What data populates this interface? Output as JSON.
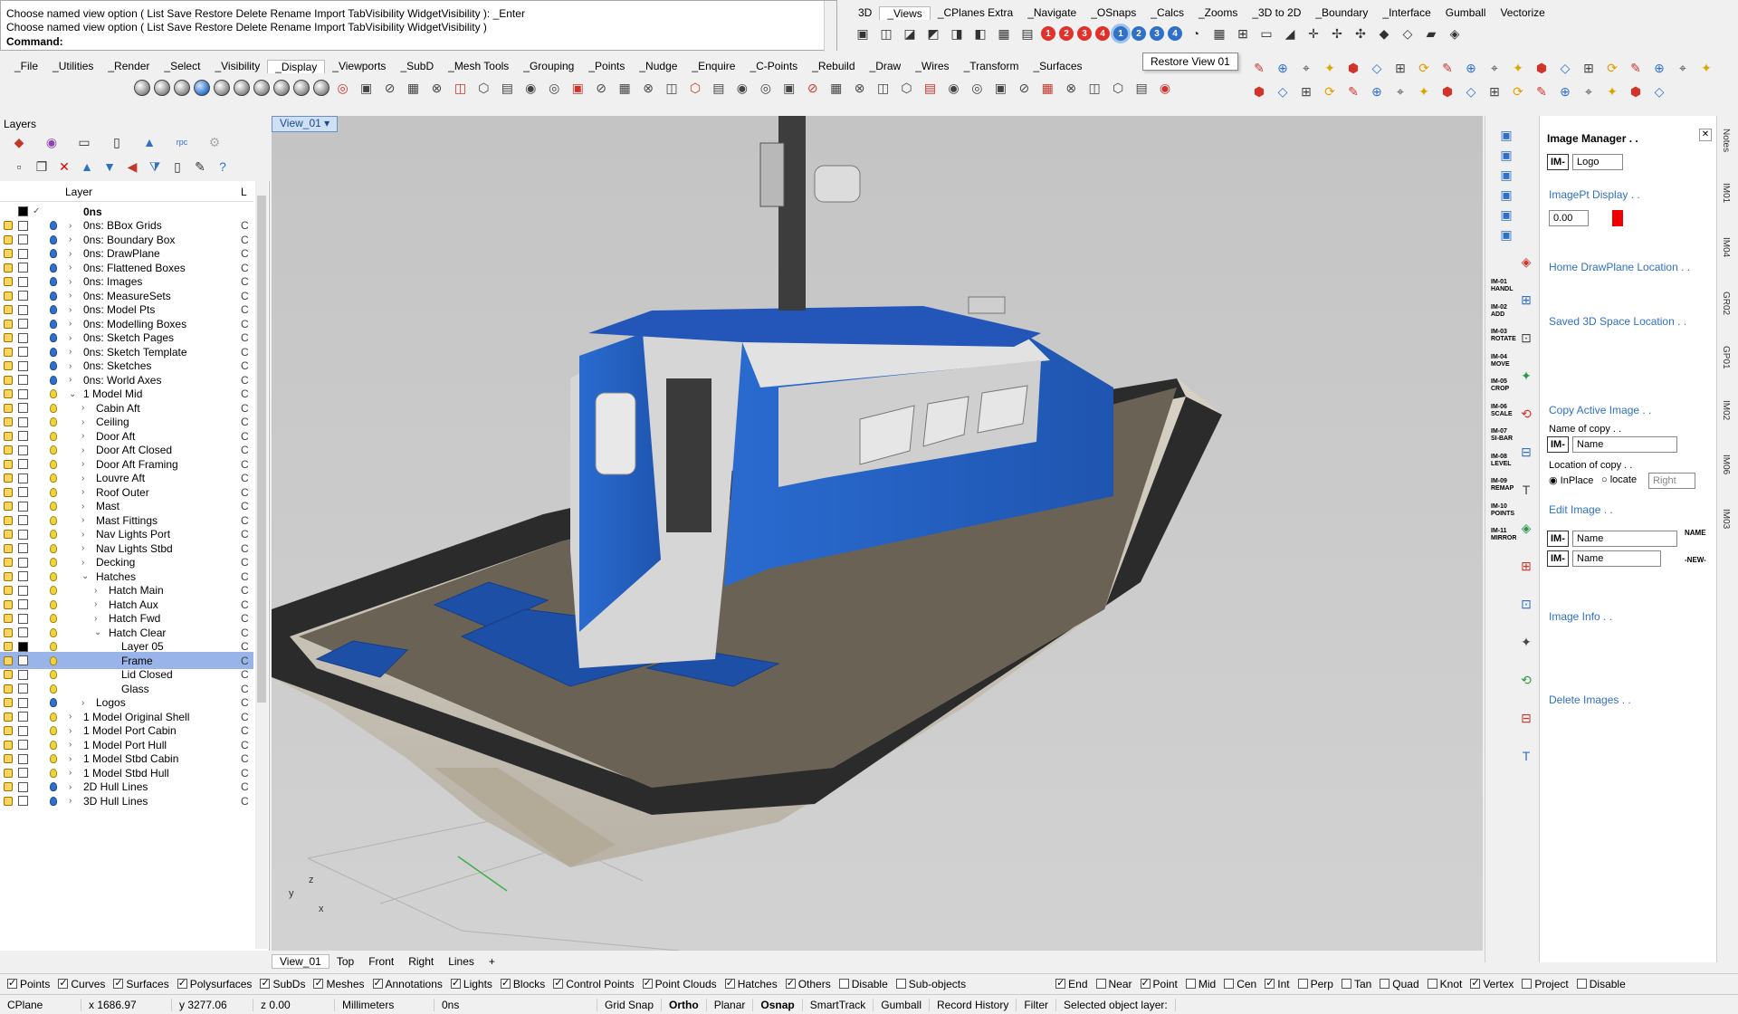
{
  "command": {
    "history": [
      "Choose named view option ( List  Save  Restore  Delete  Rename  Import  TabVisibility  WidgetVisibility ): _Enter",
      "Choose named view option ( List  Save  Restore  Delete  Rename  Import  TabVisibility  WidgetVisibility )"
    ],
    "prompt": "Command:"
  },
  "top_tabs_right": [
    "3D",
    "_Views",
    "_CPlanes Extra",
    "_Navigate",
    "_OSnaps",
    "_Calcs",
    "_Zooms",
    "_3D to 2D",
    "_Boundary",
    "_Interface",
    "Gumball",
    "Vectorize"
  ],
  "top_tabs_right_active": "_Views",
  "main_tabs": [
    "_File",
    "_Utilities",
    "_Render",
    "_Select",
    "_Visibility",
    "_Display",
    "_Viewports",
    "_SubD",
    "_Mesh Tools",
    "_Grouping",
    "_Points",
    "_Nudge",
    "_Enquire",
    "_C-Points",
    "_Rebuild",
    "_Draw",
    "_Wires",
    "_Transform",
    "_Surfaces"
  ],
  "main_tabs_active": "_Display",
  "view_buttons": [
    "1",
    "2",
    "3",
    "4",
    "1",
    "2",
    "3",
    "4"
  ],
  "tooltip": "Restore View 01",
  "layers_panel": {
    "title": "Layers",
    "column_layer": "Layer",
    "column_l": "L",
    "rows": [
      {
        "name": "0ns",
        "indent": 0,
        "caret": "",
        "bold": true,
        "bulb": "",
        "col": ""
      },
      {
        "name": "0ns: BBox Grids",
        "indent": 1,
        "caret": "›",
        "bulb": "blue",
        "col": "C"
      },
      {
        "name": "0ns: Boundary Box",
        "indent": 1,
        "caret": "›",
        "bulb": "blue",
        "col": "C"
      },
      {
        "name": "0ns: DrawPlane",
        "indent": 1,
        "caret": "›",
        "bulb": "blue",
        "col": "C"
      },
      {
        "name": "0ns: Flattened Boxes",
        "indent": 1,
        "caret": "›",
        "bulb": "blue",
        "col": "C"
      },
      {
        "name": "0ns: Images",
        "indent": 1,
        "caret": "›",
        "bulb": "blue",
        "col": "C"
      },
      {
        "name": "0ns: MeasureSets",
        "indent": 1,
        "caret": "›",
        "bulb": "blue",
        "col": "C"
      },
      {
        "name": "0ns: Model Pts",
        "indent": 1,
        "caret": "›",
        "bulb": "blue",
        "col": "C"
      },
      {
        "name": "0ns: Modelling Boxes",
        "indent": 1,
        "caret": "›",
        "bulb": "blue",
        "col": "C"
      },
      {
        "name": "0ns: Sketch Pages",
        "indent": 1,
        "caret": "›",
        "bulb": "blue",
        "col": "C"
      },
      {
        "name": "0ns: Sketch Template",
        "indent": 1,
        "caret": "›",
        "bulb": "blue",
        "col": "C"
      },
      {
        "name": "0ns: Sketches",
        "indent": 1,
        "caret": "›",
        "bulb": "blue",
        "col": "C"
      },
      {
        "name": "0ns: World Axes",
        "indent": 1,
        "caret": "›",
        "bulb": "blue",
        "col": "C"
      },
      {
        "name": "1 Model Mid",
        "indent": 1,
        "caret": "⌄",
        "bulb": "yellow",
        "col": "C"
      },
      {
        "name": "Cabin Aft",
        "indent": 2,
        "caret": "›",
        "bulb": "yellow",
        "col": "C"
      },
      {
        "name": "Ceiling",
        "indent": 2,
        "caret": "›",
        "bulb": "yellow",
        "col": "C"
      },
      {
        "name": "Door Aft",
        "indent": 2,
        "caret": "›",
        "bulb": "yellow",
        "col": "C"
      },
      {
        "name": "Door Aft Closed",
        "indent": 2,
        "caret": "›",
        "bulb": "yellow",
        "col": "C"
      },
      {
        "name": "Door Aft Framing",
        "indent": 2,
        "caret": "›",
        "bulb": "yellow",
        "col": "C"
      },
      {
        "name": "Louvre Aft",
        "indent": 2,
        "caret": "›",
        "bulb": "yellow",
        "col": "C"
      },
      {
        "name": "Roof Outer",
        "indent": 2,
        "caret": "›",
        "bulb": "yellow",
        "col": "C"
      },
      {
        "name": "Mast",
        "indent": 2,
        "caret": "›",
        "bulb": "yellow",
        "col": "C"
      },
      {
        "name": "Mast Fittings",
        "indent": 2,
        "caret": "›",
        "bulb": "yellow",
        "col": "C"
      },
      {
        "name": "Nav Lights Port",
        "indent": 2,
        "caret": "›",
        "bulb": "yellow",
        "col": "C"
      },
      {
        "name": "Nav Lights Stbd",
        "indent": 2,
        "caret": "›",
        "bulb": "yellow",
        "col": "C"
      },
      {
        "name": "Decking",
        "indent": 2,
        "caret": "›",
        "bulb": "yellow",
        "col": "C"
      },
      {
        "name": "Hatches",
        "indent": 2,
        "caret": "⌄",
        "bulb": "yellow",
        "col": "C"
      },
      {
        "name": "Hatch Main",
        "indent": 3,
        "caret": "›",
        "bulb": "yellow",
        "col": "C"
      },
      {
        "name": "Hatch Aux",
        "indent": 3,
        "caret": "›",
        "bulb": "yellow",
        "col": "C"
      },
      {
        "name": "Hatch Fwd",
        "indent": 3,
        "caret": "›",
        "bulb": "yellow",
        "col": "C"
      },
      {
        "name": "Hatch Clear",
        "indent": 3,
        "caret": "⌄",
        "bulb": "yellow",
        "col": "C"
      },
      {
        "name": "Layer 05",
        "indent": 4,
        "caret": "",
        "bulb": "yellow",
        "col": "C",
        "black": true
      },
      {
        "name": "Frame",
        "indent": 4,
        "caret": "",
        "bulb": "yellow",
        "col": "C",
        "selected": true
      },
      {
        "name": "Lid Closed",
        "indent": 4,
        "caret": "",
        "bulb": "yellow",
        "col": "C"
      },
      {
        "name": "Glass",
        "indent": 4,
        "caret": "",
        "bulb": "yellow",
        "col": "C"
      },
      {
        "name": "Logos",
        "indent": 2,
        "caret": "›",
        "bulb": "blue",
        "col": "C"
      },
      {
        "name": "1 Model Original Shell",
        "indent": 1,
        "caret": "›",
        "bulb": "yellow",
        "col": "C"
      },
      {
        "name": "1 Model Port Cabin",
        "indent": 1,
        "caret": "›",
        "bulb": "yellow",
        "col": "C"
      },
      {
        "name": "1 Model Port Hull",
        "indent": 1,
        "caret": "›",
        "bulb": "yellow",
        "col": "C"
      },
      {
        "name": "1 Model Stbd Cabin",
        "indent": 1,
        "caret": "›",
        "bulb": "yellow",
        "col": "C"
      },
      {
        "name": "1 Model Stbd Hull",
        "indent": 1,
        "caret": "›",
        "bulb": "yellow",
        "col": "C"
      },
      {
        "name": "2D Hull Lines",
        "indent": 1,
        "caret": "›",
        "bulb": "blue",
        "col": "C"
      },
      {
        "name": "3D Hull Lines",
        "indent": 1,
        "caret": "›",
        "bulb": "blue",
        "col": "C"
      }
    ]
  },
  "viewport": {
    "name": "View_01"
  },
  "bottom_view_tabs": [
    "View_01",
    "Top",
    "Front",
    "Right",
    "Lines",
    "+"
  ],
  "image_manager": {
    "title": "Image Manager . .",
    "im_prefix": "IM-",
    "logo_value": "Logo",
    "imagept_display": "ImagePt Display . .",
    "spinner_value": "0.00",
    "home_drawplane": "Home DrawPlane Location . .",
    "saved_3d": "Saved 3D Space Location . .",
    "copy_active": "Copy Active Image . .",
    "name_of_copy": "Name of copy . .",
    "name_placeholder": "Name",
    "location_of_copy": "Location of copy . .",
    "inplace": "InPlace",
    "locate": "locate",
    "right": "Right",
    "edit_image": "Edit Image . .",
    "name_btn": "NAME",
    "new_btn": "-NEW-",
    "image_info": "Image Info . .",
    "delete_images": "Delete Images . ."
  },
  "right_tool_labels": [
    "IM-01 HANDL",
    "IM-02 ADD",
    "IM-03 ROTATE",
    "IM-04 MOVE",
    "IM-05 CROP",
    "IM-06 SCALE",
    "IM-07 SI-BAR",
    "IM-08 LEVEL",
    "IM-09 REMAP",
    "IM-10 POINTS",
    "IM-11 MIRROR"
  ],
  "vertical_tabs": [
    "Notes",
    "IM01",
    "IM04",
    "GR02",
    "GP01",
    "IM02",
    "IM06",
    "IM03"
  ],
  "filters": [
    {
      "label": "Points",
      "on": true
    },
    {
      "label": "Curves",
      "on": true
    },
    {
      "label": "Surfaces",
      "on": true
    },
    {
      "label": "Polysurfaces",
      "on": true
    },
    {
      "label": "SubDs",
      "on": true
    },
    {
      "label": "Meshes",
      "on": true
    },
    {
      "label": "Annotations",
      "on": true
    },
    {
      "label": "Lights",
      "on": true
    },
    {
      "label": "Blocks",
      "on": true
    },
    {
      "label": "Control Points",
      "on": true
    },
    {
      "label": "Point Clouds",
      "on": true
    },
    {
      "label": "Hatches",
      "on": true
    },
    {
      "label": "Others",
      "on": true
    },
    {
      "label": "Disable",
      "on": false
    },
    {
      "label": "Sub-objects",
      "on": false
    }
  ],
  "osnaps": [
    {
      "label": "End",
      "on": true
    },
    {
      "label": "Near",
      "on": false
    },
    {
      "label": "Point",
      "on": true
    },
    {
      "label": "Mid",
      "on": false
    },
    {
      "label": "Cen",
      "on": false
    },
    {
      "label": "Int",
      "on": true
    },
    {
      "label": "Perp",
      "on": false
    },
    {
      "label": "Tan",
      "on": false
    },
    {
      "label": "Quad",
      "on": false
    },
    {
      "label": "Knot",
      "on": false
    },
    {
      "label": "Vertex",
      "on": true
    },
    {
      "label": "Project",
      "on": false
    },
    {
      "label": "Disable",
      "on": false
    }
  ],
  "status": {
    "cplane": "CPlane",
    "x": "x 1686.97",
    "y": "y 3277.06",
    "z": "z 0.00",
    "units": "Millimeters",
    "layer": "0ns",
    "grid_snap": "Grid Snap",
    "ortho": "Ortho",
    "planar": "Planar",
    "osnap": "Osnap",
    "smarttrack": "SmartTrack",
    "gumball": "Gumball",
    "record_history": "Record History",
    "filter": "Filter",
    "message": "Selected object layer:"
  },
  "axis_labels": {
    "z": "z",
    "y": "y",
    "x": "x"
  },
  "colors": {
    "accent": "#2f70c8",
    "boat_blue": "#2e6fcf",
    "deck": "#6b6255",
    "selection": "#99b4e8"
  }
}
